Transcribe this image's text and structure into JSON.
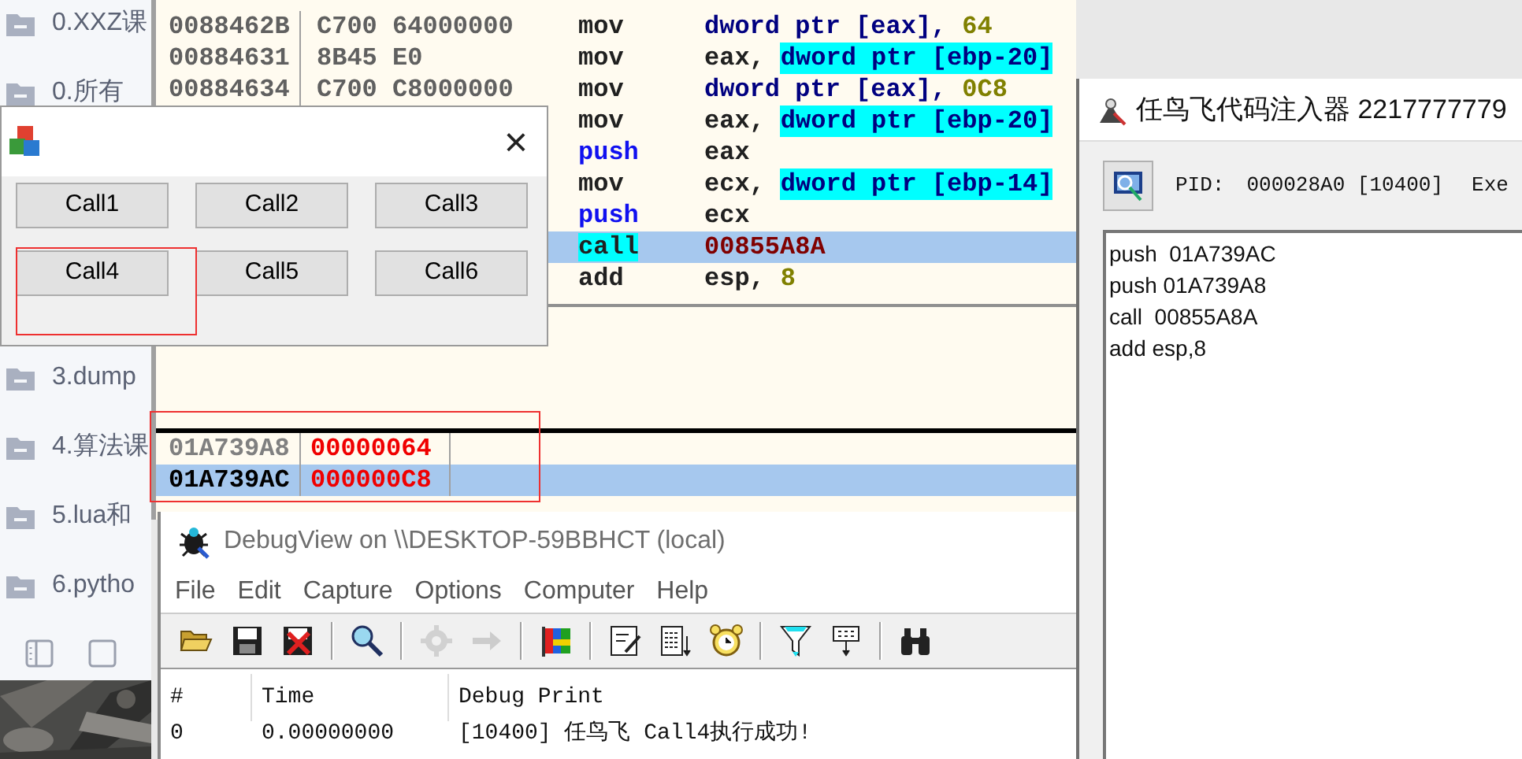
{
  "sidebar": {
    "items": [
      {
        "label": "0.XXZ课"
      },
      {
        "label": "0.所有"
      },
      {
        "label": "3.dump"
      },
      {
        "label": "4.算法课"
      },
      {
        "label": "5.lua和"
      },
      {
        "label": "6.pytho"
      }
    ]
  },
  "debugger": {
    "disassembly": [
      {
        "address": "0088462B",
        "bytes": "C700 64000000",
        "selected": false,
        "mnemonic": {
          "text": "mov",
          "kind": "plain",
          "highlighted": false
        },
        "operands": [
          {
            "text": "dword ptr [eax],",
            "kind": "mem",
            "highlighted": false
          },
          {
            "text": "64",
            "kind": "imm",
            "highlighted": false
          }
        ]
      },
      {
        "address": "00884631",
        "bytes": "8B45 E0",
        "selected": false,
        "mnemonic": {
          "text": "mov",
          "kind": "plain",
          "highlighted": false
        },
        "operands": [
          {
            "text": "eax,",
            "kind": "reg",
            "highlighted": false
          },
          {
            "text": "dword ptr [ebp-20]",
            "kind": "mem",
            "highlighted": true
          }
        ]
      },
      {
        "address": "00884634",
        "bytes": "C700 C8000000",
        "selected": false,
        "mnemonic": {
          "text": "mov",
          "kind": "plain",
          "highlighted": false
        },
        "operands": [
          {
            "text": "dword ptr [eax],",
            "kind": "mem",
            "highlighted": false
          },
          {
            "text": "0C8",
            "kind": "imm",
            "highlighted": false
          }
        ]
      },
      {
        "selected": false,
        "mnemonic": {
          "text": "mov",
          "kind": "plain",
          "highlighted": false
        },
        "operands": [
          {
            "text": "eax,",
            "kind": "reg",
            "highlighted": false
          },
          {
            "text": "dword ptr [ebp-20]",
            "kind": "mem",
            "highlighted": true
          }
        ]
      },
      {
        "selected": false,
        "mnemonic": {
          "text": "push",
          "kind": "stack",
          "highlighted": false
        },
        "operands": [
          {
            "text": "eax",
            "kind": "reg",
            "highlighted": false
          }
        ]
      },
      {
        "selected": false,
        "mnemonic": {
          "text": "mov",
          "kind": "plain",
          "highlighted": false
        },
        "operands": [
          {
            "text": "ecx,",
            "kind": "reg",
            "highlighted": false
          },
          {
            "text": "dword ptr [ebp-14]",
            "kind": "mem",
            "highlighted": true
          }
        ]
      },
      {
        "selected": false,
        "mnemonic": {
          "text": "push",
          "kind": "stack",
          "highlighted": false
        },
        "operands": [
          {
            "text": "ecx",
            "kind": "reg",
            "highlighted": false
          }
        ]
      },
      {
        "selected": true,
        "mnemonic": {
          "text": "call",
          "kind": "plain",
          "highlighted": true
        },
        "operands": [
          {
            "text": "00855A8A",
            "kind": "addr",
            "highlighted": false
          }
        ]
      },
      {
        "selected": false,
        "mnemonic": {
          "text": "add",
          "kind": "plain",
          "highlighted": false
        },
        "operands": [
          {
            "text": "esp,",
            "kind": "reg",
            "highlighted": false
          },
          {
            "text": "8",
            "kind": "imm",
            "highlighted": false
          }
        ]
      }
    ],
    "memory_dump": {
      "boxed": true,
      "rows": [
        {
          "address": "01A739A8",
          "value": "00000064",
          "selected": false
        },
        {
          "address": "01A739AC",
          "value": "000000C8",
          "selected": true
        }
      ]
    }
  },
  "dialog": {
    "buttons": [
      {
        "label": "Call1",
        "boxed": false
      },
      {
        "label": "Call2",
        "boxed": false
      },
      {
        "label": "Call3",
        "boxed": false
      },
      {
        "label": "Call4",
        "boxed": true
      },
      {
        "label": "Call5",
        "boxed": false
      },
      {
        "label": "Call6",
        "boxed": false
      }
    ],
    "close": "×"
  },
  "injector": {
    "title": "任鸟飞代码注入器 2217777779",
    "pid_label": "PID:",
    "pid_value": "000028A0 [10400]",
    "cut_label": "Exe",
    "code_lines": [
      "push  01A739AC",
      "push 01A739A8",
      "call  00855A8A",
      "add esp,8"
    ]
  },
  "debugview": {
    "title": "DebugView on \\\\DESKTOP-59BBHCT (local)",
    "menu": [
      "File",
      "Edit",
      "Capture",
      "Options",
      "Computer",
      "Help"
    ],
    "toolbar": [
      {
        "disabled": false,
        "separator_after": false
      },
      {
        "disabled": false,
        "separator_after": false
      },
      {
        "disabled": false,
        "separator_after": true
      },
      {
        "disabled": false,
        "separator_after": true
      },
      {
        "disabled": true,
        "separator_after": false
      },
      {
        "disabled": true,
        "separator_after": true
      },
      {
        "disabled": false,
        "separator_after": true
      },
      {
        "disabled": false,
        "separator_after": false
      },
      {
        "disabled": false,
        "separator_after": false
      },
      {
        "disabled": false,
        "separator_after": true
      },
      {
        "disabled": false,
        "separator_after": false
      },
      {
        "disabled": false,
        "separator_after": true
      },
      {
        "disabled": false,
        "separator_after": false
      }
    ],
    "columns": [
      "#",
      "Time",
      "Debug Print"
    ],
    "rows": [
      [
        "0",
        "0.00000000",
        "[10400] 任鸟飞 Call4执行成功!"
      ]
    ]
  }
}
